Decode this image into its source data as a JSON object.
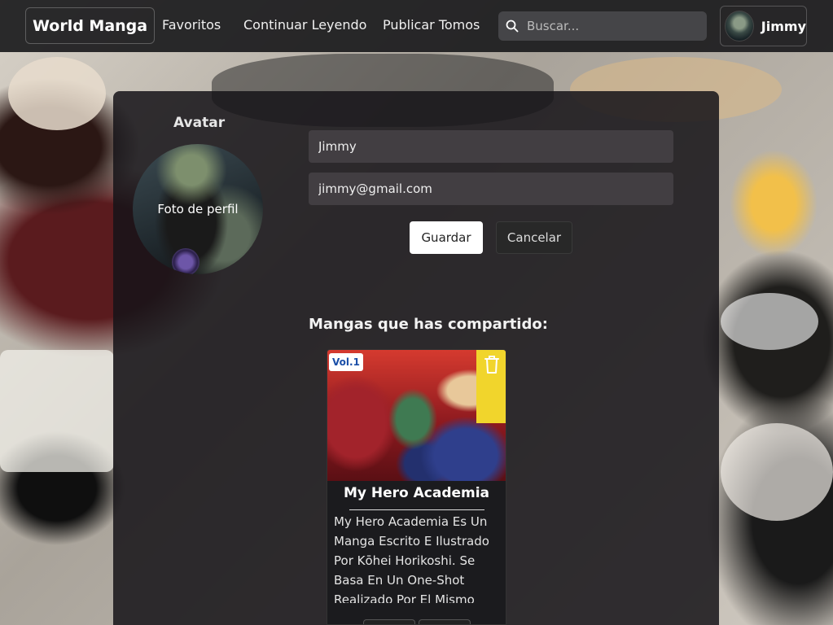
{
  "navbar": {
    "brand": "World Manga",
    "links": [
      "Favoritos",
      "Continuar Leyendo",
      "Publicar Tomos"
    ],
    "search_placeholder": "Buscar...",
    "user_name": "Jimmy"
  },
  "profile": {
    "avatar_title": "Avatar",
    "avatar_caption": "Foto de perfil",
    "name_value": "Jimmy",
    "email_value": "jimmy@gmail.com",
    "save_label": "Guardar",
    "cancel_label": "Cancelar"
  },
  "shared": {
    "title": "Mangas que has compartido:",
    "items": [
      {
        "title": "My Hero Academia",
        "cover_label": "Vol.1",
        "description": "My Hero Academia Es Un Manga Escrito E Ilustrado Por Kōhei Horikoshi. Se Basa En Un One-Shot Realizado Por El Mismo"
      }
    ]
  },
  "icons": {
    "search": "search-icon",
    "delete": "trash-icon"
  },
  "colors": {
    "navbar_bg": "#1c1c1e",
    "panel_bg": "#161418",
    "save_button_bg": "#ffffff",
    "field_bg": "#464246"
  }
}
